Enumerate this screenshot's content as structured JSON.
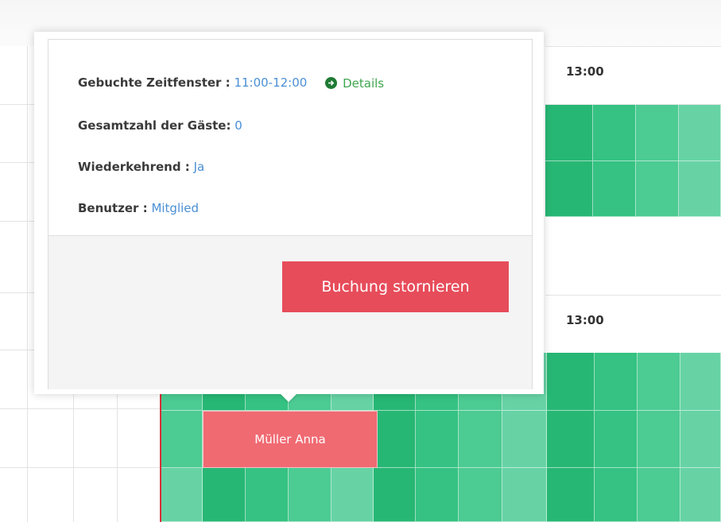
{
  "popover": {
    "booked_slot_label": "Gebuchte Zeitfenster :",
    "booked_slot_value": "11:00-12:00",
    "details_link": "Details",
    "guests_label": "Gesamtzahl der Gäste:",
    "guests_value": "0",
    "recurring_label": "Wiederkehrend :",
    "recurring_value": "Ja",
    "user_label": "Benutzer :",
    "user_value": "Mitglied",
    "cancel_button": "Buchung stornieren"
  },
  "schedule": {
    "header_time_1": "13:00",
    "header_time_2": "13:00",
    "booking_name": "Müller Anna"
  },
  "colors": {
    "green_dark": "#27b774",
    "green_light": "#67d3a5",
    "booking": "#f06a72",
    "cancel": "#e74c5a",
    "link": "#4a8fd4",
    "details": "#3fa64f"
  }
}
